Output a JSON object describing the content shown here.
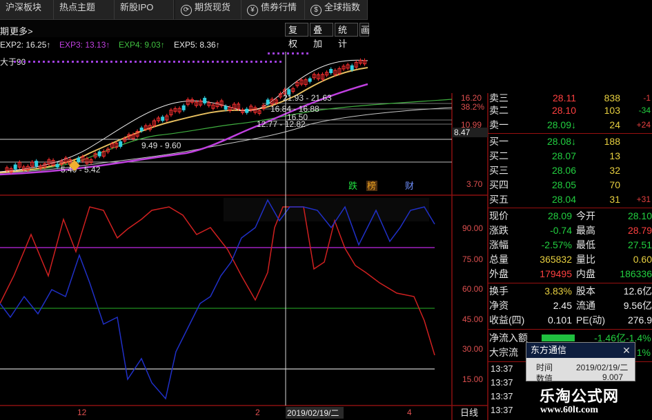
{
  "toolbar": {
    "tabs": [
      "沪深板块",
      "热点主题",
      "新股IPO"
    ],
    "buttons": [
      "期货现货",
      "债券行情",
      "全球指数"
    ]
  },
  "sub_toolbar": {
    "left": "期",
    "more": "更多>",
    "buttons": [
      "复权",
      "叠加",
      "统计",
      "画"
    ]
  },
  "legend": {
    "exp2": "EXP2: 16.25↑",
    "exp3": "EXP3: 13.13↑",
    "exp4": "EXP4: 9.03↑",
    "exp5": "EXP5: 8.36↑",
    "condition": "大于90"
  },
  "price_chart": {
    "annotations": [
      "21.93 - 21.63",
      "16.84 - 16.88",
      "16.50",
      "12.77 - 12.82",
      "9.49 - 9.60",
      "5.40 - 5.42"
    ],
    "right_labels": [
      "16.20",
      "38.2%",
      "10.99",
      "8.47",
      "3.70"
    ],
    "markers": [
      {
        "text": "跌",
        "color": "#20e040"
      },
      {
        "text": "榜",
        "color": "#e8a020"
      },
      {
        "text": "财",
        "color": "#7090ff"
      }
    ]
  },
  "oscillator": {
    "axis_labels": [
      "90.00",
      "75.00",
      "60.00",
      "45.00",
      "30.00",
      "15.00"
    ]
  },
  "time_axis": {
    "ticks": [
      "12",
      "2",
      "4"
    ],
    "cursor_date": "2019/02/19/二",
    "period": "日线"
  },
  "order_book": {
    "asks": [
      {
        "label": "卖二",
        "price": "28.10",
        "volume": "103",
        "change": "-34"
      },
      {
        "label": "卖一",
        "price": "28.09↓",
        "volume": "24",
        "change": "+24"
      }
    ],
    "bids": [
      {
        "label": "买一",
        "price": "28.08↓",
        "volume": "188",
        "change": ""
      },
      {
        "label": "买二",
        "price": "28.07",
        "volume": "13",
        "change": ""
      },
      {
        "label": "买三",
        "price": "28.06",
        "volume": "32",
        "change": ""
      },
      {
        "label": "买四",
        "price": "28.05",
        "volume": "70",
        "change": ""
      },
      {
        "label": "买五",
        "price": "28.04",
        "volume": "31",
        "change": "+31"
      }
    ]
  },
  "quote": {
    "rows": [
      {
        "l1": "现价",
        "v1": "28.09",
        "l2": "今开",
        "v2": "28.10"
      },
      {
        "l1": "涨跌",
        "v1": "-0.74",
        "l2": "最高",
        "v2": "28.79"
      },
      {
        "l1": "涨幅",
        "v1": "-2.57%",
        "l2": "最低",
        "v2": "27.51"
      },
      {
        "l1": "总量",
        "v1": "365832",
        "l2": "量比",
        "v2": "0.60"
      },
      {
        "l1": "外盘",
        "v1": "179495",
        "l2": "内盘",
        "v2": "186336"
      },
      {
        "l1": "换手",
        "v1": "3.83%",
        "l2": "股本",
        "v2": "12.6亿"
      },
      {
        "l1": "净资",
        "v1": "2.45",
        "l2": "流通",
        "v2": "9.56亿"
      },
      {
        "l1": "收益(四)",
        "v1": "0.101",
        "l2": "PE(动)",
        "v2": "276.9"
      }
    ],
    "net_inflow_label": "净流入额",
    "net_inflow_value": "-1.46亿",
    "net_inflow_pct": "-1.4%",
    "block_label": "大宗流",
    "block_pct": "1%"
  },
  "ticks": [
    "13:37",
    "13:37",
    "13:37",
    "13:37",
    "13:37"
  ],
  "popup": {
    "title": "东方通信",
    "time_label": "时间",
    "time_value": "2019/02/19/二",
    "row2_label": "数值",
    "row2_value": "9.007"
  },
  "watermark": {
    "line1": "乐淘公式网",
    "line2": "www.60lt.com"
  },
  "colors": {
    "up": "#ff4040",
    "down": "#22d040",
    "exp2": "#e8e8e8",
    "exp3": "#c040e0",
    "exp4": "#40c040",
    "osc_red": "#d02020",
    "osc_blue": "#2020c0"
  }
}
